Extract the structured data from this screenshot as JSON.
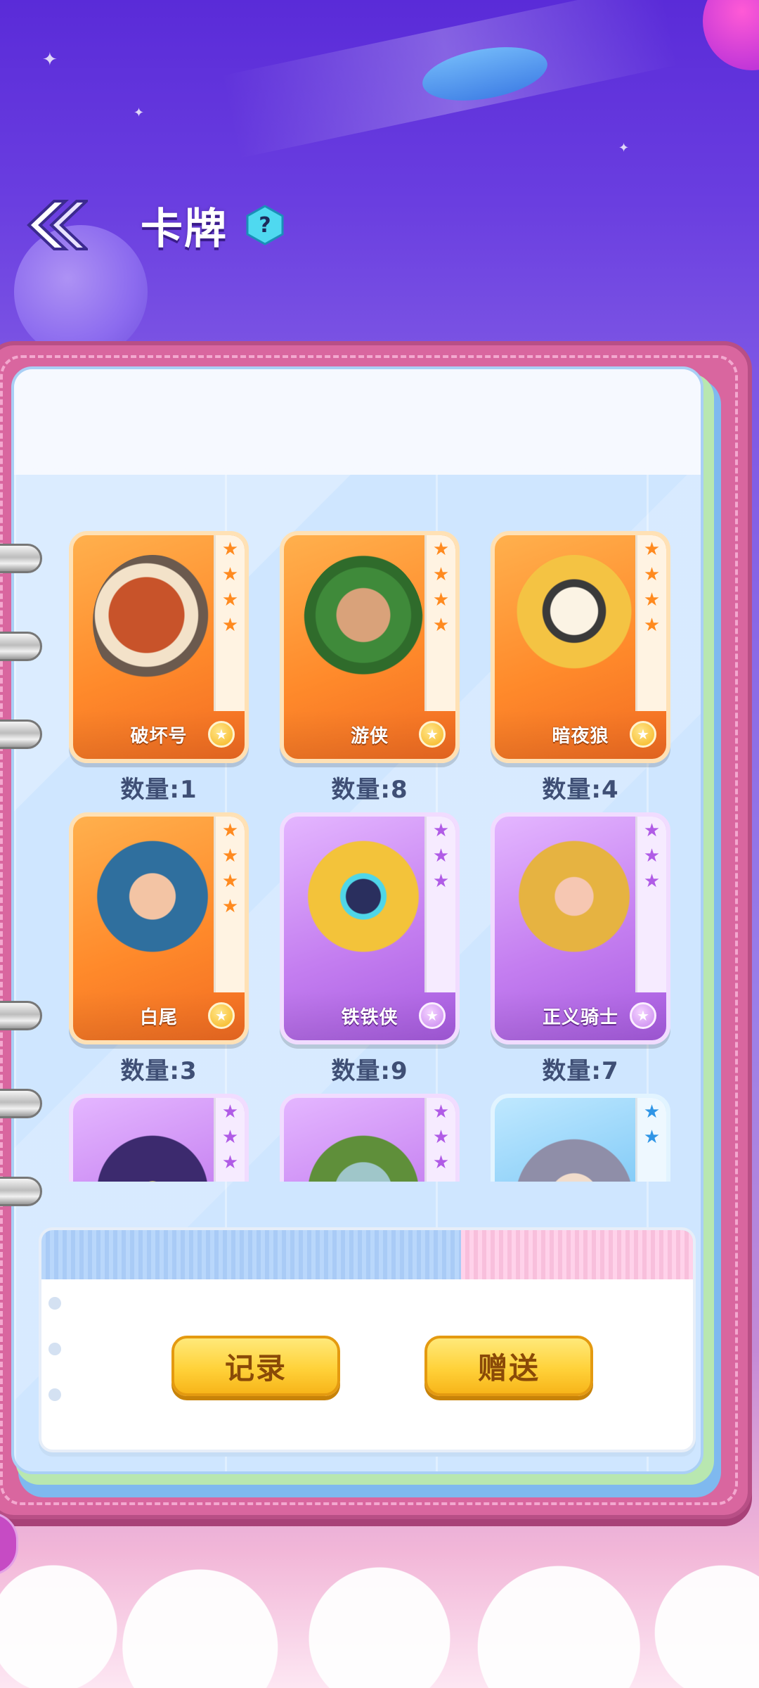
{
  "header": {
    "title": "卡牌",
    "help_label": "?"
  },
  "cards": [
    {
      "name": "破坏号",
      "quantity": "数量:1",
      "rarity": "orange",
      "stars": 4
    },
    {
      "name": "游侠",
      "quantity": "数量:8",
      "rarity": "orange",
      "stars": 4
    },
    {
      "name": "暗夜狼",
      "quantity": "数量:4",
      "rarity": "orange",
      "stars": 4
    },
    {
      "name": "白尾",
      "quantity": "数量:3",
      "rarity": "orange",
      "stars": 4
    },
    {
      "name": "铁铁侠",
      "quantity": "数量:9",
      "rarity": "purple",
      "stars": 3
    },
    {
      "name": "正义骑士",
      "quantity": "数量:7",
      "rarity": "purple",
      "stars": 3
    },
    {
      "name": "",
      "quantity": "",
      "rarity": "purple",
      "stars": 3
    },
    {
      "name": "",
      "quantity": "",
      "rarity": "purple",
      "stars": 3
    },
    {
      "name": "",
      "quantity": "",
      "rarity": "blue",
      "stars": 2
    }
  ],
  "actions": {
    "record_label": "记录",
    "gift_label": "赠送"
  },
  "colors": {
    "accent": "#ffd23a",
    "orange_card": "#ff8a2b",
    "purple_card": "#c47ef0",
    "blue_card": "#7cc8f6"
  }
}
